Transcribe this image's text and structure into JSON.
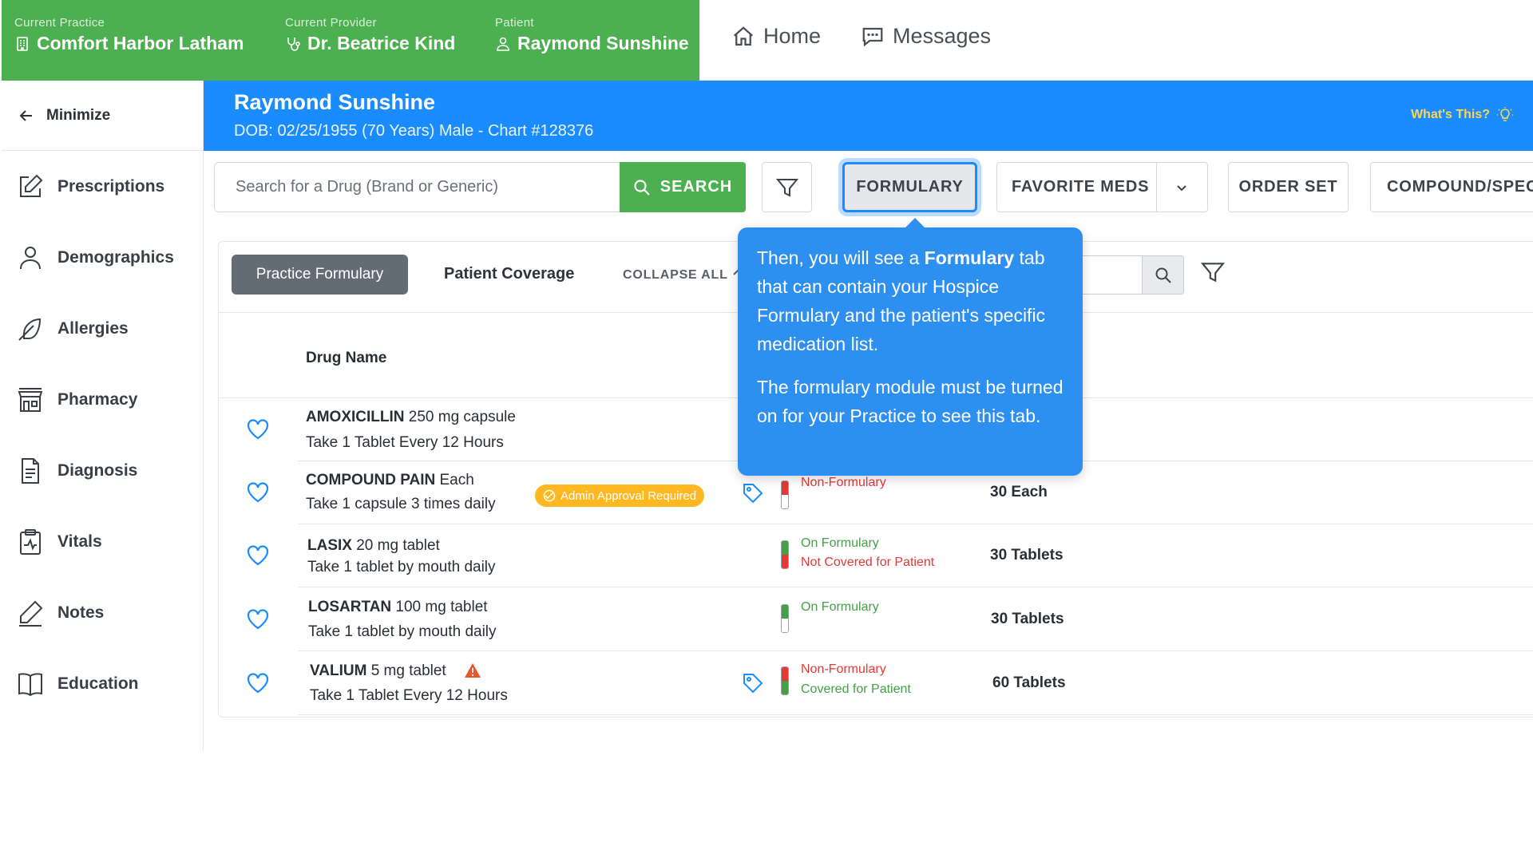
{
  "header": {
    "practice_label": "Current Practice",
    "practice_value": "Comfort Harbor Latham",
    "provider_label": "Current Provider",
    "provider_value": "Dr. Beatrice Kind",
    "patient_label": "Patient",
    "patient_value": "Raymond Sunshine",
    "nav_home": "Home",
    "nav_messages": "Messages"
  },
  "sidebar": {
    "minimize": "Minimize",
    "items": [
      {
        "label": "Prescriptions",
        "icon": "edit-square-icon"
      },
      {
        "label": "Demographics",
        "icon": "user-icon"
      },
      {
        "label": "Allergies",
        "icon": "feather-icon"
      },
      {
        "label": "Pharmacy",
        "icon": "storefront-icon"
      },
      {
        "label": "Diagnosis",
        "icon": "document-icon"
      },
      {
        "label": "Vitals",
        "icon": "clipboard-pulse-icon"
      },
      {
        "label": "Notes",
        "icon": "pen-icon"
      },
      {
        "label": "Education",
        "icon": "book-icon"
      }
    ]
  },
  "banner": {
    "name": "Raymond Sunshine",
    "info": "DOB: 02/25/1955 (70 Years) Male - Chart #128376",
    "whats_this": "What's This?"
  },
  "toolbar": {
    "search_placeholder": "Search for a Drug (Brand or Generic)",
    "search_button": "SEARCH",
    "formulary": "FORMULARY",
    "favorite_meds": "FAVORITE MEDS",
    "order_set": "ORDER SET",
    "compound": "COMPOUND/SPECI"
  },
  "panel": {
    "tab_practice": "Practice Formulary",
    "tab_patient": "Patient Coverage",
    "collapse_all": "COLLAPSE ALL",
    "col_drug_name": "Drug Name"
  },
  "rows": [
    {
      "name": "AMOXICILLIN",
      "strength": " 250 mg capsule",
      "sig": "Take 1 Tablet Every 12 Hours",
      "status1": "",
      "status2": "",
      "qty": ""
    },
    {
      "name": "COMPOUND PAIN",
      "strength": " Each",
      "sig": "Take 1 capsule 3 times daily",
      "badge": "Admin Approval Required",
      "status1": "Non-Formulary",
      "status2": "",
      "qty": "30 Each"
    },
    {
      "name": "LASIX",
      "strength": " 20 mg tablet",
      "sig": "Take 1 tablet by mouth daily",
      "status1": "On Formulary",
      "status2": "Not Covered for Patient",
      "qty": "30 Tablets"
    },
    {
      "name": "LOSARTAN",
      "strength": " 100 mg tablet",
      "sig": "Take 1 tablet by mouth daily",
      "status1": "On Formulary",
      "status2": "",
      "qty": "30 Tablets"
    },
    {
      "name": "VALIUM",
      "strength": " 5 mg tablet",
      "sig": "Take 1 Tablet Every 12 Hours",
      "status1": "Non-Formulary",
      "status2": "Covered for Patient",
      "qty": "60 Tablets"
    }
  ],
  "tooltip": {
    "p1_pre": "Then, you will see a ",
    "p1_bold": "Formulary",
    "p1_post": " tab that can contain your Hospice Formulary and the patient's specific medication list.",
    "p2": "The formulary module must be turned on for your Practice to see this tab."
  },
  "colors": {
    "green": "#4caf50",
    "blue": "#1a8cff",
    "tooltip": "#2d8ff0",
    "badge": "#ffb81f",
    "red": "#e53935"
  }
}
